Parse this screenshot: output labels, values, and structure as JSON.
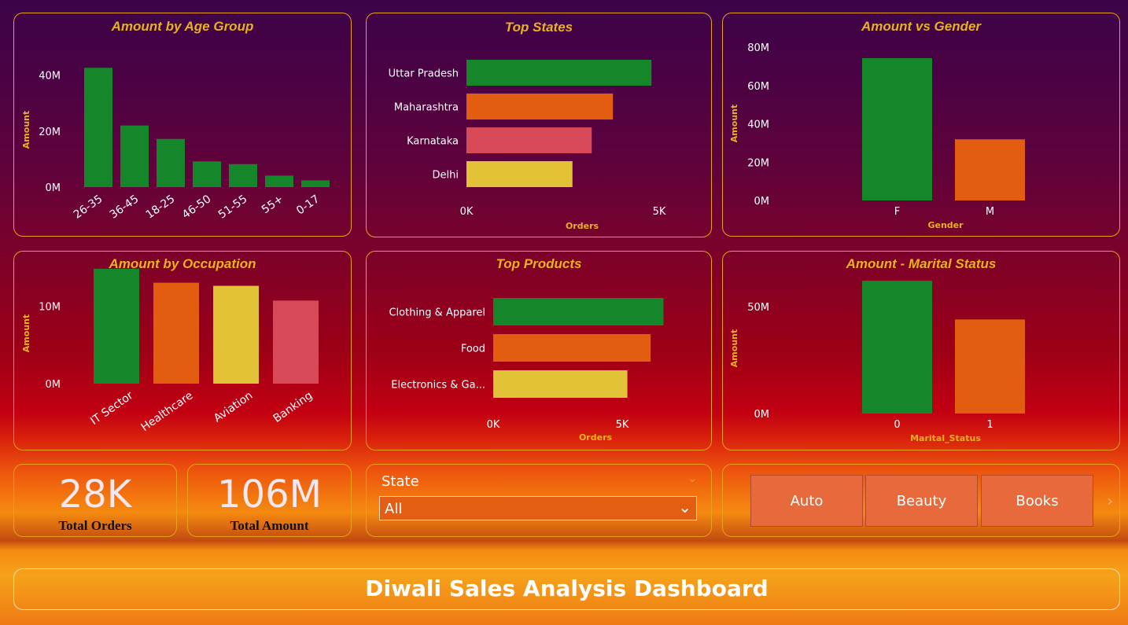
{
  "colors": {
    "green": "#15872a",
    "orange": "#e35d10",
    "red": "#d94a58",
    "yellow": "#e2c337",
    "title": "#e7b21c",
    "axis_text": "#ffffff"
  },
  "panels": {
    "age": {
      "title": "Amount by Age Group",
      "chart_data": {
        "type": "bar",
        "categories": [
          "26-35",
          "36-45",
          "18-25",
          "46-50",
          "51-55",
          "55+",
          "0-17"
        ],
        "values": [
          42.6,
          22.0,
          17.2,
          9.2,
          8.2,
          4.1,
          2.4
        ],
        "ylabel": "Amount",
        "xlabel": "",
        "ylim": [
          0,
          48
        ],
        "yticks": [
          "0M",
          "20M",
          "40M"
        ],
        "ytick_values": [
          0,
          20,
          40
        ],
        "bar_colors": [
          "#15872a"
        ]
      }
    },
    "states": {
      "title": "Top States",
      "chart_data": {
        "type": "bar",
        "orientation": "horizontal",
        "categories": [
          "Uttar Pradesh",
          "Maharashtra",
          "Karnataka",
          "Delhi"
        ],
        "values": [
          4800,
          3800,
          3250,
          2750
        ],
        "xlabel": "Orders",
        "xlim": [
          0,
          5000
        ],
        "xticks": [
          "0K",
          "5K"
        ],
        "xtick_values": [
          0,
          5000
        ],
        "bar_colors": [
          "#15872a",
          "#e35d10",
          "#d94a58",
          "#e2c337"
        ]
      }
    },
    "gender": {
      "title": "Amount vs Gender",
      "chart_data": {
        "type": "bar",
        "categories": [
          "F",
          "M"
        ],
        "values": [
          74.3,
          31.9
        ],
        "xlabel": "Gender",
        "ylabel": "Amount",
        "ylim": [
          0,
          80
        ],
        "yticks": [
          "0M",
          "20M",
          "40M",
          "60M",
          "80M"
        ],
        "ytick_values": [
          0,
          20,
          40,
          60,
          80
        ],
        "bar_colors": [
          "#15872a",
          "#e35d10"
        ]
      }
    },
    "occupation": {
      "title": "Amount by Occupation",
      "chart_data": {
        "type": "bar",
        "categories": [
          "IT Sector",
          "Healthcare",
          "Aviation",
          "Banking"
        ],
        "values": [
          14.8,
          13.0,
          12.6,
          10.7
        ],
        "ylabel": "Amount",
        "xlabel": "",
        "ylim": [
          0,
          16
        ],
        "yticks": [
          "0M",
          "10M"
        ],
        "ytick_values": [
          0,
          10
        ],
        "bar_colors": [
          "#15872a",
          "#e35d10",
          "#e2c337",
          "#d94a58"
        ]
      }
    },
    "products": {
      "title": "Top Products",
      "chart_data": {
        "type": "bar",
        "orientation": "horizontal",
        "categories": [
          "Clothing & Apparel",
          "Food",
          "Electronics & Ga..."
        ],
        "values": [
          6600,
          6100,
          5200
        ],
        "xlabel": "Orders",
        "xlim": [
          0,
          5000
        ],
        "xticks": [
          "0K",
          "5K"
        ],
        "xtick_values": [
          0,
          5000
        ],
        "bar_colors": [
          "#15872a",
          "#e35d10",
          "#e2c337"
        ]
      }
    },
    "marital": {
      "title": "Amount - Marital Status",
      "chart_data": {
        "type": "bar",
        "categories": [
          "0",
          "1"
        ],
        "values": [
          62.1,
          44.0
        ],
        "xlabel": "Marital_Status",
        "ylabel": "Amount",
        "ylim": [
          0,
          50
        ],
        "yticks": [
          "0M",
          "50M"
        ],
        "ytick_values": [
          0,
          50
        ],
        "bar_colors": [
          "#15872a",
          "#e35d10"
        ]
      }
    }
  },
  "kpis": {
    "orders": {
      "value": "28K",
      "label": "Total Orders"
    },
    "amount": {
      "value": "106M",
      "label": "Total Amount"
    }
  },
  "slicer": {
    "title": "State",
    "selected": "All",
    "collapse_icon": "chevron-down-icon",
    "dropdown_icon": "chevron-down-icon"
  },
  "category_tiles": {
    "items": [
      "Auto",
      "Beauty",
      "Books"
    ],
    "next_icon": "chevron-right-icon"
  },
  "banner": {
    "title": "Diwali Sales Analysis Dashboard"
  }
}
